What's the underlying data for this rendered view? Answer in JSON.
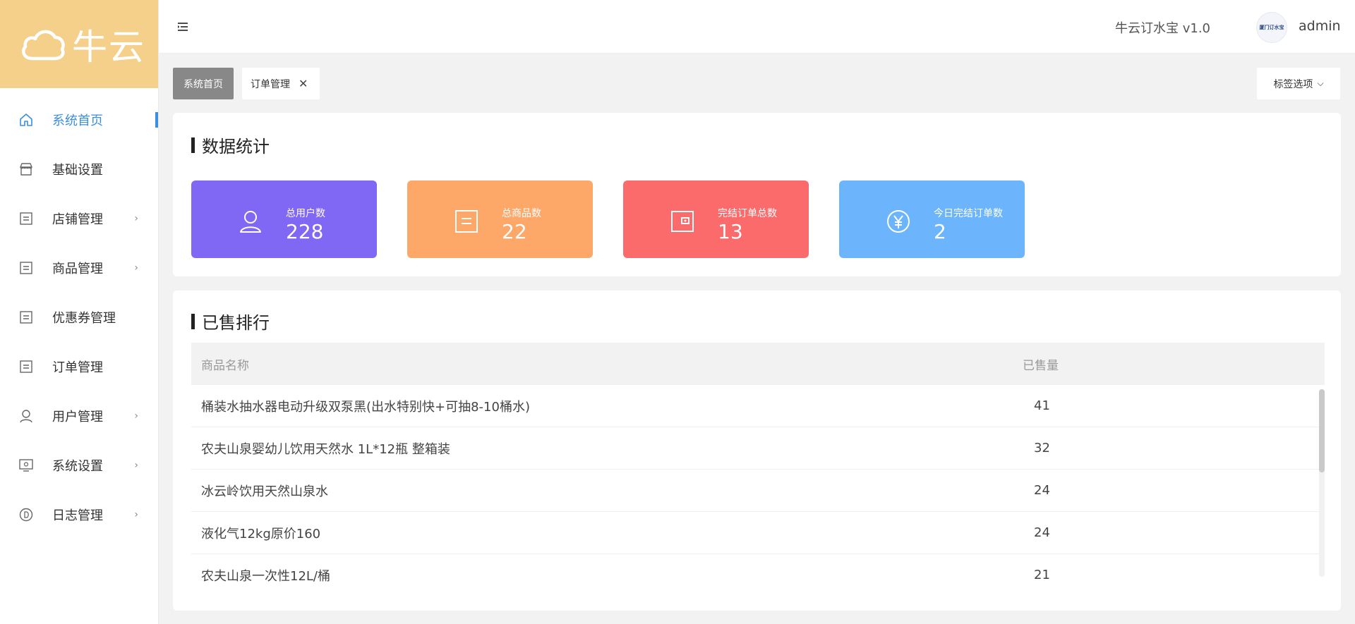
{
  "logo": {
    "text": "牛云"
  },
  "sidebar": {
    "items": [
      {
        "label": "系统首页",
        "icon": "home-icon",
        "has_children": false,
        "active": true
      },
      {
        "label": "基础设置",
        "icon": "store-icon",
        "has_children": false
      },
      {
        "label": "店铺管理",
        "icon": "list-icon",
        "has_children": true
      },
      {
        "label": "商品管理",
        "icon": "list-icon",
        "has_children": true
      },
      {
        "label": "优惠券管理",
        "icon": "list-icon",
        "has_children": false
      },
      {
        "label": "订单管理",
        "icon": "list-icon",
        "has_children": false
      },
      {
        "label": "用户管理",
        "icon": "user-icon",
        "has_children": true
      },
      {
        "label": "系统设置",
        "icon": "monitor-icon",
        "has_children": true
      },
      {
        "label": "日志管理",
        "icon": "log-icon",
        "has_children": true
      }
    ],
    "chevron": "›"
  },
  "header": {
    "app_title": "牛云订水宝 v1.0",
    "username": "admin",
    "avatar_text": "厦门订水宝"
  },
  "tabs": {
    "home_label": "系统首页",
    "order_label": "订单管理",
    "close_glyph": "✕",
    "options_label": "标签选项",
    "options_caret": "⌵"
  },
  "stats": {
    "title": "数据统计",
    "cards": [
      {
        "label": "总用户数",
        "value": "228",
        "color": "#8168f4",
        "icon": "user-icon"
      },
      {
        "label": "总商品数",
        "value": "22",
        "color": "#fda769",
        "icon": "goods-icon"
      },
      {
        "label": "完结订单总数",
        "value": "13",
        "color": "#fc6b6b",
        "icon": "wallet-icon"
      },
      {
        "label": "今日完结订单数",
        "value": "2",
        "color": "#6cb5fd",
        "icon": "yen-icon"
      }
    ]
  },
  "ranking": {
    "title": "已售排行",
    "columns": {
      "name": "商品名称",
      "sold": "已售量"
    },
    "rows": [
      {
        "name": "桶装水抽水器电动升级双泵黑(出水特别快+可抽8-10桶水)",
        "sold": "41"
      },
      {
        "name": "农夫山泉婴幼儿饮用天然水 1L*12瓶 整箱装",
        "sold": "32"
      },
      {
        "name": "冰云岭饮用天然山泉水",
        "sold": "24"
      },
      {
        "name": "液化气12kg原价160",
        "sold": "24"
      },
      {
        "name": "农夫山泉一次性12L/桶",
        "sold": "21"
      }
    ]
  },
  "colors": {
    "accent": "#3b8ee0",
    "logo_bg": "#f5d08b",
    "tab_active_bg": "#888888"
  }
}
